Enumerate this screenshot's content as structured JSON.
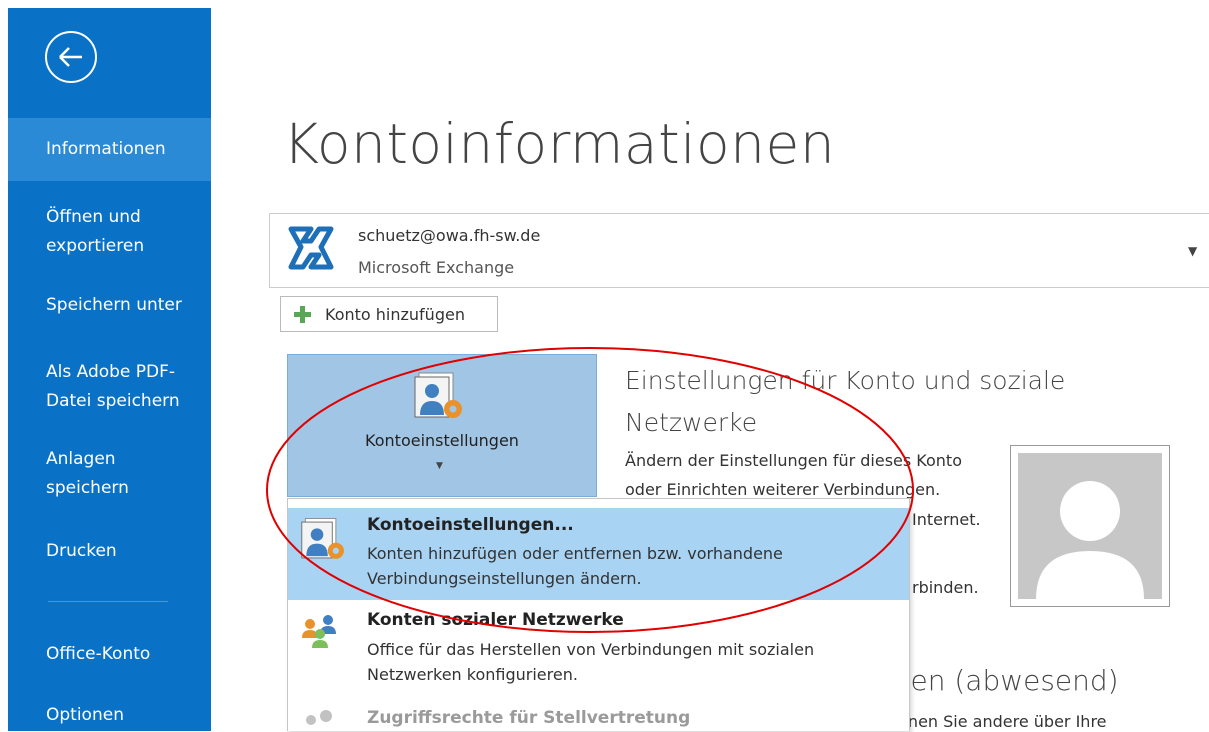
{
  "sidebar": {
    "back_label": "",
    "items": [
      {
        "label": "Informationen",
        "active": true
      },
      {
        "label": "Öffnen und exportieren"
      },
      {
        "label": "Speichern unter"
      },
      {
        "label": "Als Adobe PDF-Datei speichern"
      },
      {
        "label": "Anlagen speichern"
      },
      {
        "label": "Drucken"
      },
      {
        "label": "Office-Konto"
      },
      {
        "label": "Optionen"
      }
    ]
  },
  "main": {
    "title": "Kontoinformationen",
    "account": {
      "email": "schuetz@owa.fh-sw.de",
      "type": "Microsoft Exchange"
    },
    "add_account_label": "Konto hinzufügen",
    "settings_button_label": "Kontoeinstellungen",
    "section_title": "Einstellungen für Konto und soziale Netzwerke",
    "section_desc": "Ändern der Einstellungen für dieses Konto oder Einrichten weiterer Verbindungen.",
    "bg_fragments": {
      "internet": "Internet.",
      "verbinden": "rbinden."
    },
    "out_of_office_title_fragment": "rten (abwesend)",
    "out_of_office_desc_fragment": "önnen Sie andere über Ihre"
  },
  "dropdown": {
    "items": [
      {
        "title": "Kontoeinstellungen...",
        "desc": "Konten hinzufügen oder entfernen bzw. vorhandene Verbindungseinstellungen ändern.",
        "selected": true
      },
      {
        "title": "Konten sozialer Netzwerke",
        "desc": "Office für das Herstellen von Verbindungen mit sozialen Netzwerken konfigurieren."
      },
      {
        "title": "Zugriffsrechte für Stellvertretung",
        "disabled": true
      }
    ]
  },
  "colors": {
    "sidebar_bg": "#0a72c6",
    "sidebar_active": "#2b8ad6",
    "selected_item": "#a9d3f3",
    "settings_button_bg": "#a1c6e5",
    "annotation": "#e00000"
  }
}
